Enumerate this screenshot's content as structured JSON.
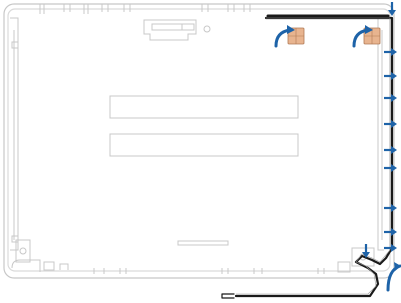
{
  "diagram": {
    "subject": "laptop-display-back-cover",
    "view": "inside",
    "colors": {
      "outline": "#c8c8c8",
      "outline_light": "#dadada",
      "cable": "#1a1a1a",
      "cable_inner": "#9a9a9a",
      "tape": "#e8b48f",
      "tape_edge": "#b07a55",
      "arrow": "#1e63a8",
      "background": "#ffffff"
    },
    "icons": {
      "down_arrow": "arrow-down-icon",
      "right_arrow": "arrow-right-icon",
      "curved_arrow": "curved-arrow-icon",
      "tape": "adhesive-tape-icon"
    },
    "counts": {
      "down_arrows": 2,
      "right_arrows": 9,
      "curved_arrows": 3,
      "tape_pieces": 2,
      "label_areas": 2
    }
  }
}
